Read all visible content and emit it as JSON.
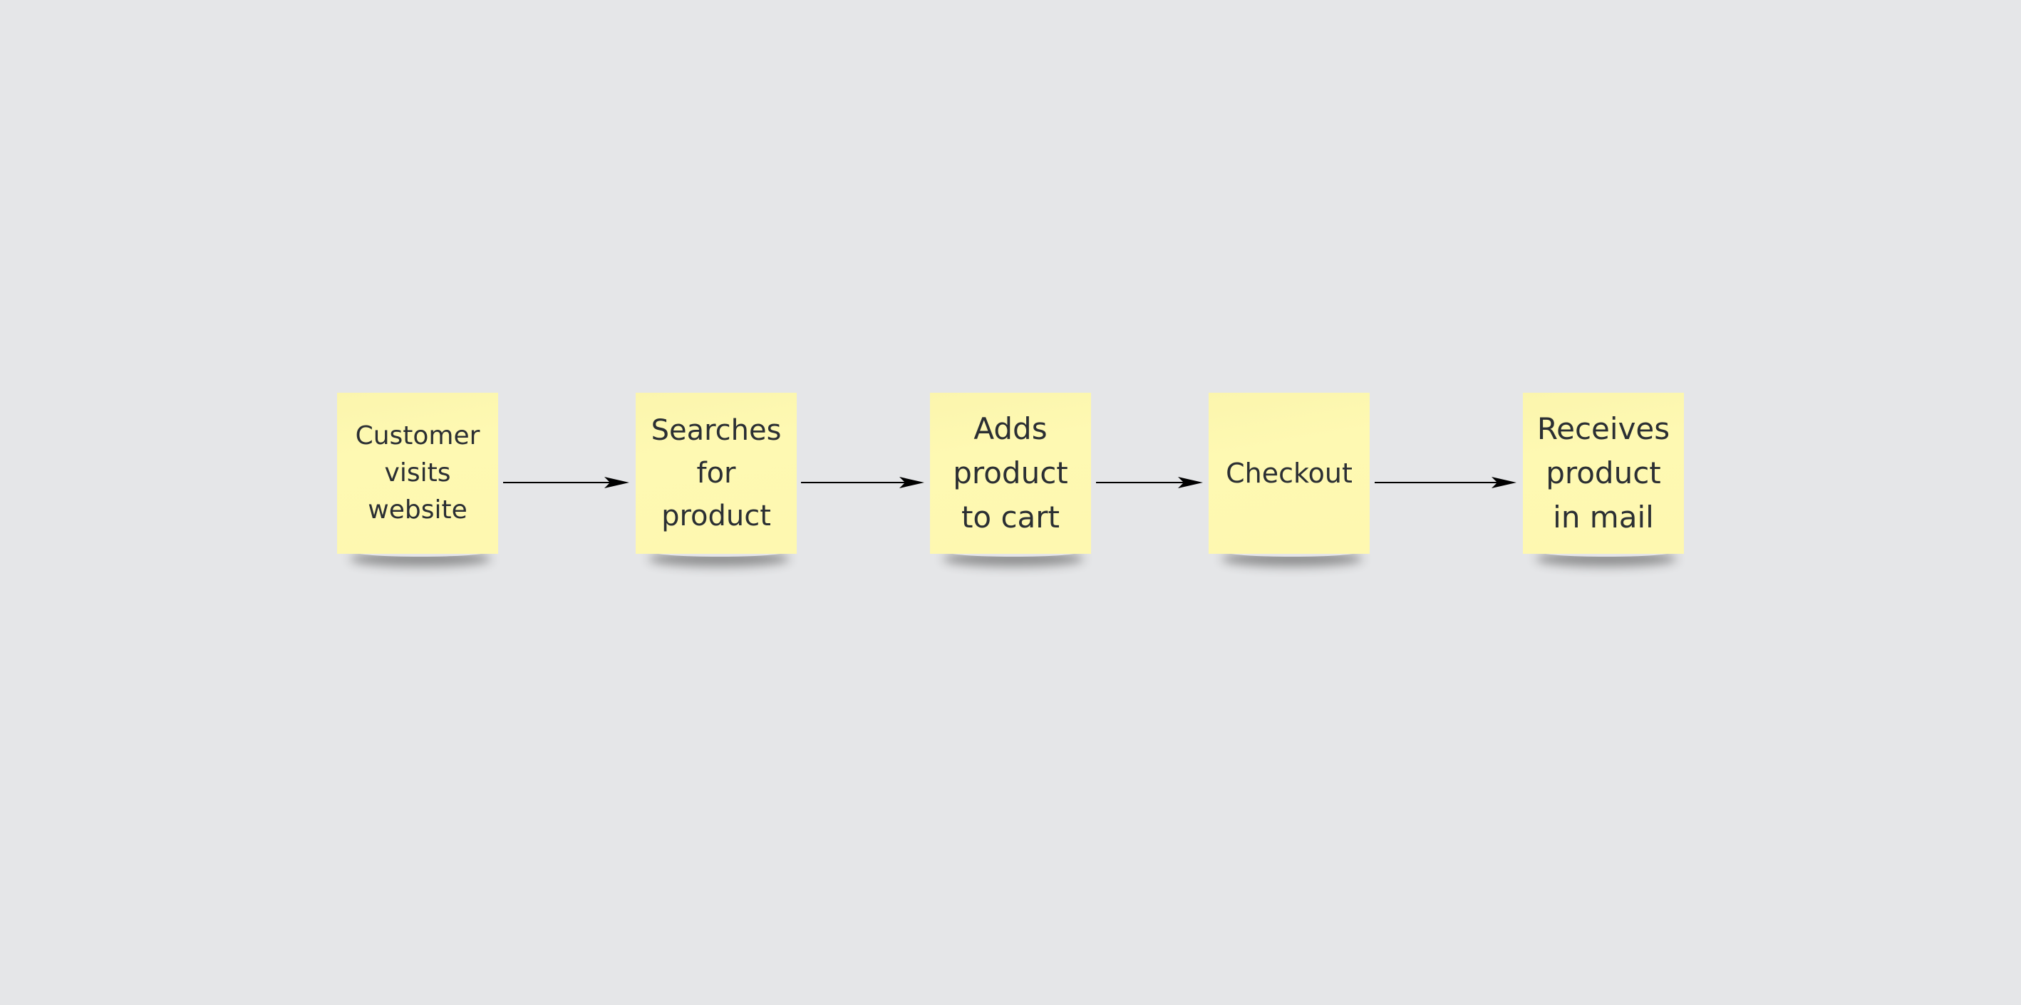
{
  "board": {
    "background_color": "#e5e6e8",
    "note_color": "#fef9b2",
    "text_color": "#2b2f33",
    "arrow_color": "#000000"
  },
  "notes": [
    {
      "id": "note-1",
      "text": "Customer\nvisits\nwebsite"
    },
    {
      "id": "note-2",
      "text": "Searches\nfor\nproduct"
    },
    {
      "id": "note-3",
      "text": "Adds\nproduct\nto cart"
    },
    {
      "id": "note-4",
      "text": "Checkout"
    },
    {
      "id": "note-5",
      "text": "Receives\nproduct\nin mail"
    }
  ],
  "connectors": [
    {
      "from": "note-1",
      "to": "note-2",
      "type": "arrow"
    },
    {
      "from": "note-2",
      "to": "note-3",
      "type": "arrow"
    },
    {
      "from": "note-3",
      "to": "note-4",
      "type": "arrow"
    },
    {
      "from": "note-4",
      "to": "note-5",
      "type": "arrow"
    }
  ]
}
